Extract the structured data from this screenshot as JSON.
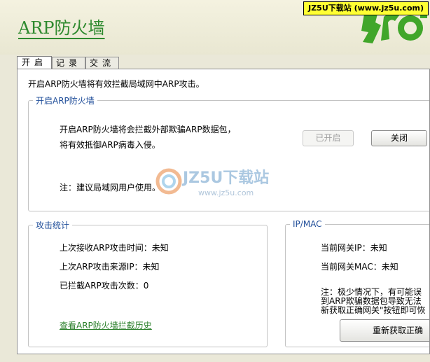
{
  "app": {
    "title": "ARP防火墙",
    "watermark_banner": "JZ5U下载站 (www.jz5u.com)"
  },
  "tabs": [
    {
      "label": "开启",
      "active": true
    },
    {
      "label": "记录",
      "active": false
    },
    {
      "label": "交流",
      "active": false
    }
  ],
  "intro": "开启ARP防火墙将有效拦截局域网中ARP攻击。",
  "firewall_group": {
    "legend": "开启ARP防火墙",
    "desc_line1": "开启ARP防火墙将会拦截外部欺骗ARP数据包，",
    "desc_line2": "将有效抵御ARP病毒入侵。",
    "note": "注：建议局域网用户使用。",
    "enabled_button": "已开启",
    "close_button": "关闭"
  },
  "stats_group": {
    "legend": "攻击统计",
    "last_time": "上次接收ARP攻击时间：未知",
    "last_ip": "上次ARP攻击来源IP：未知",
    "count": "已拦截ARP攻击次数：0",
    "history_link": "查看ARP防火墙拦截历史"
  },
  "ipmac_group": {
    "legend": "IP/MAC",
    "gateway_ip": "当前网关IP：未知",
    "gateway_mac": "当前网关MAC：未知",
    "note_line1": "注：极少情况下，有可能误",
    "note_line2": "到ARP欺骗数据包导致无法",
    "note_line3": "新获取正确网关\"按钮即可恢",
    "refresh_button": "重新获取正确"
  },
  "watermark": {
    "brand": "JZ5U下载站",
    "url": "www.jz5u.com"
  },
  "colors": {
    "title": "#2f8a2f",
    "legend": "#1f4d99",
    "link": "#2a7f2a",
    "logo": "#41a62a"
  }
}
